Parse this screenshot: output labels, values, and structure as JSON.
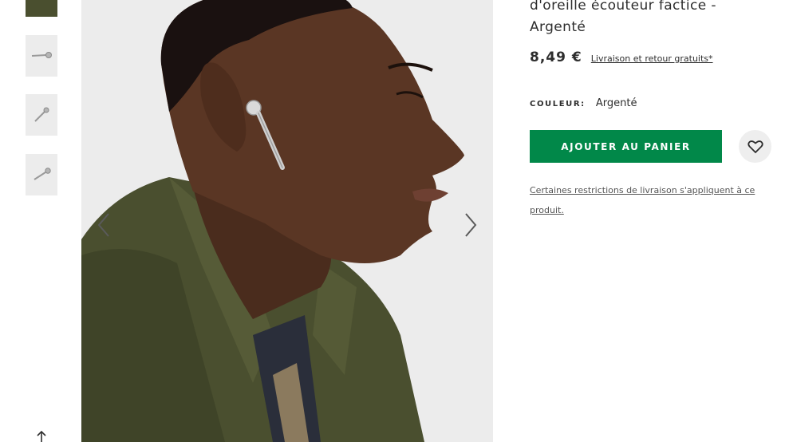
{
  "product": {
    "title": "d'oreille écouteur factice - Argenté",
    "price": "8,49 €",
    "shipping_link": "Livraison et retour gratuits*",
    "colour_label": "COULEUR:",
    "colour_value": "Argenté",
    "add_to_bag_label": "AJOUTER AU PANIER",
    "restrictions_link": "Certaines restrictions de livraison s'appliquent à ce produit."
  },
  "gallery": {
    "thumbnail_count": 4,
    "prev_icon": "chevron-left-icon",
    "next_icon": "chevron-right-icon"
  },
  "icons": {
    "wishlist": "heart-icon",
    "share": "share-icon"
  },
  "colors": {
    "accent_green": "#018849",
    "text": "#2d2d2d",
    "image_bg": "#ececec",
    "shirt": "#4a4f2f"
  }
}
